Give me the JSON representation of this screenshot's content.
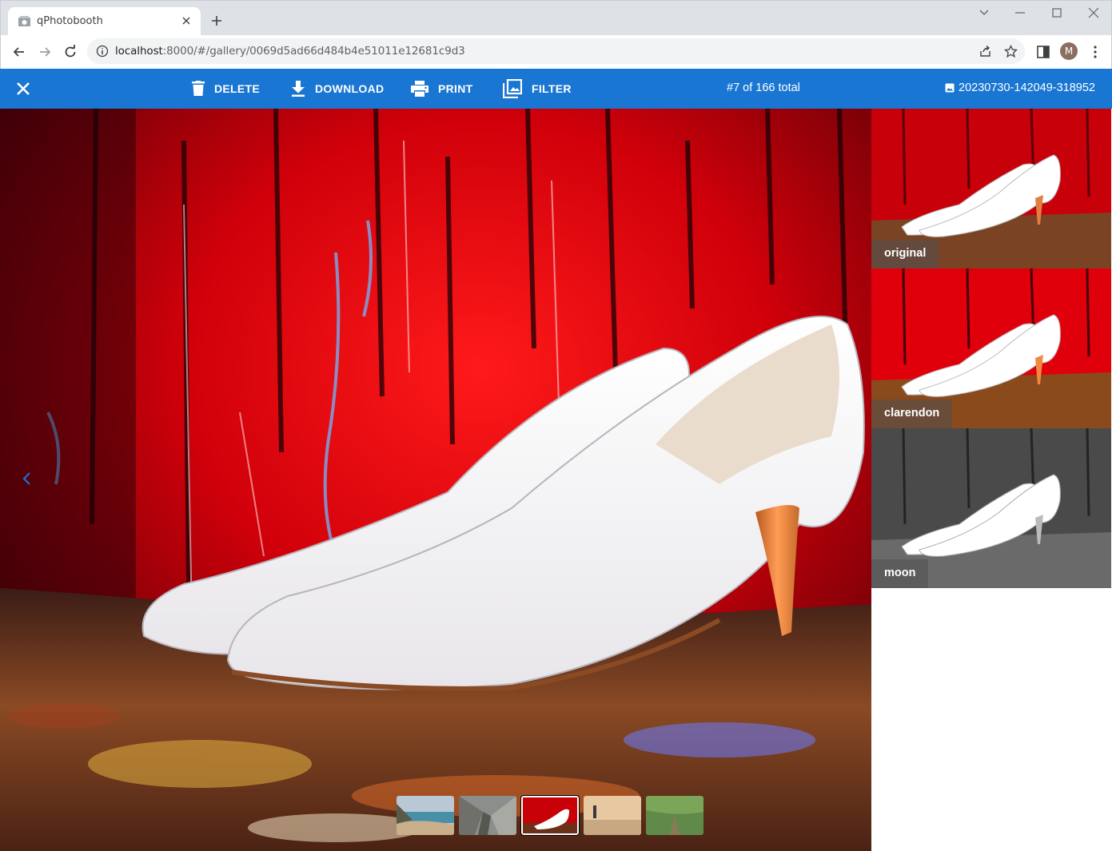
{
  "browser": {
    "tab_title": "qPhotobooth",
    "url_host": "localhost",
    "url_rest": ":8000/#/gallery/0069d5ad66d484b4e51011e12681c9d3",
    "avatar_letter": "M"
  },
  "appbar": {
    "color": "#1976d2",
    "delete_label": "DELETE",
    "download_label": "DOWNLOAD",
    "print_label": "PRINT",
    "filter_label": "FILTER",
    "counter": "#7 of 166 total",
    "filename": "20230730-142049-318952"
  },
  "filters": [
    {
      "label": "original"
    },
    {
      "label": "clarendon"
    },
    {
      "label": "moon"
    }
  ],
  "thumbnails": [
    {
      "name": "beach"
    },
    {
      "name": "rocks"
    },
    {
      "name": "white-heels",
      "active": true
    },
    {
      "name": "person-sunset"
    },
    {
      "name": "forest-path"
    }
  ]
}
